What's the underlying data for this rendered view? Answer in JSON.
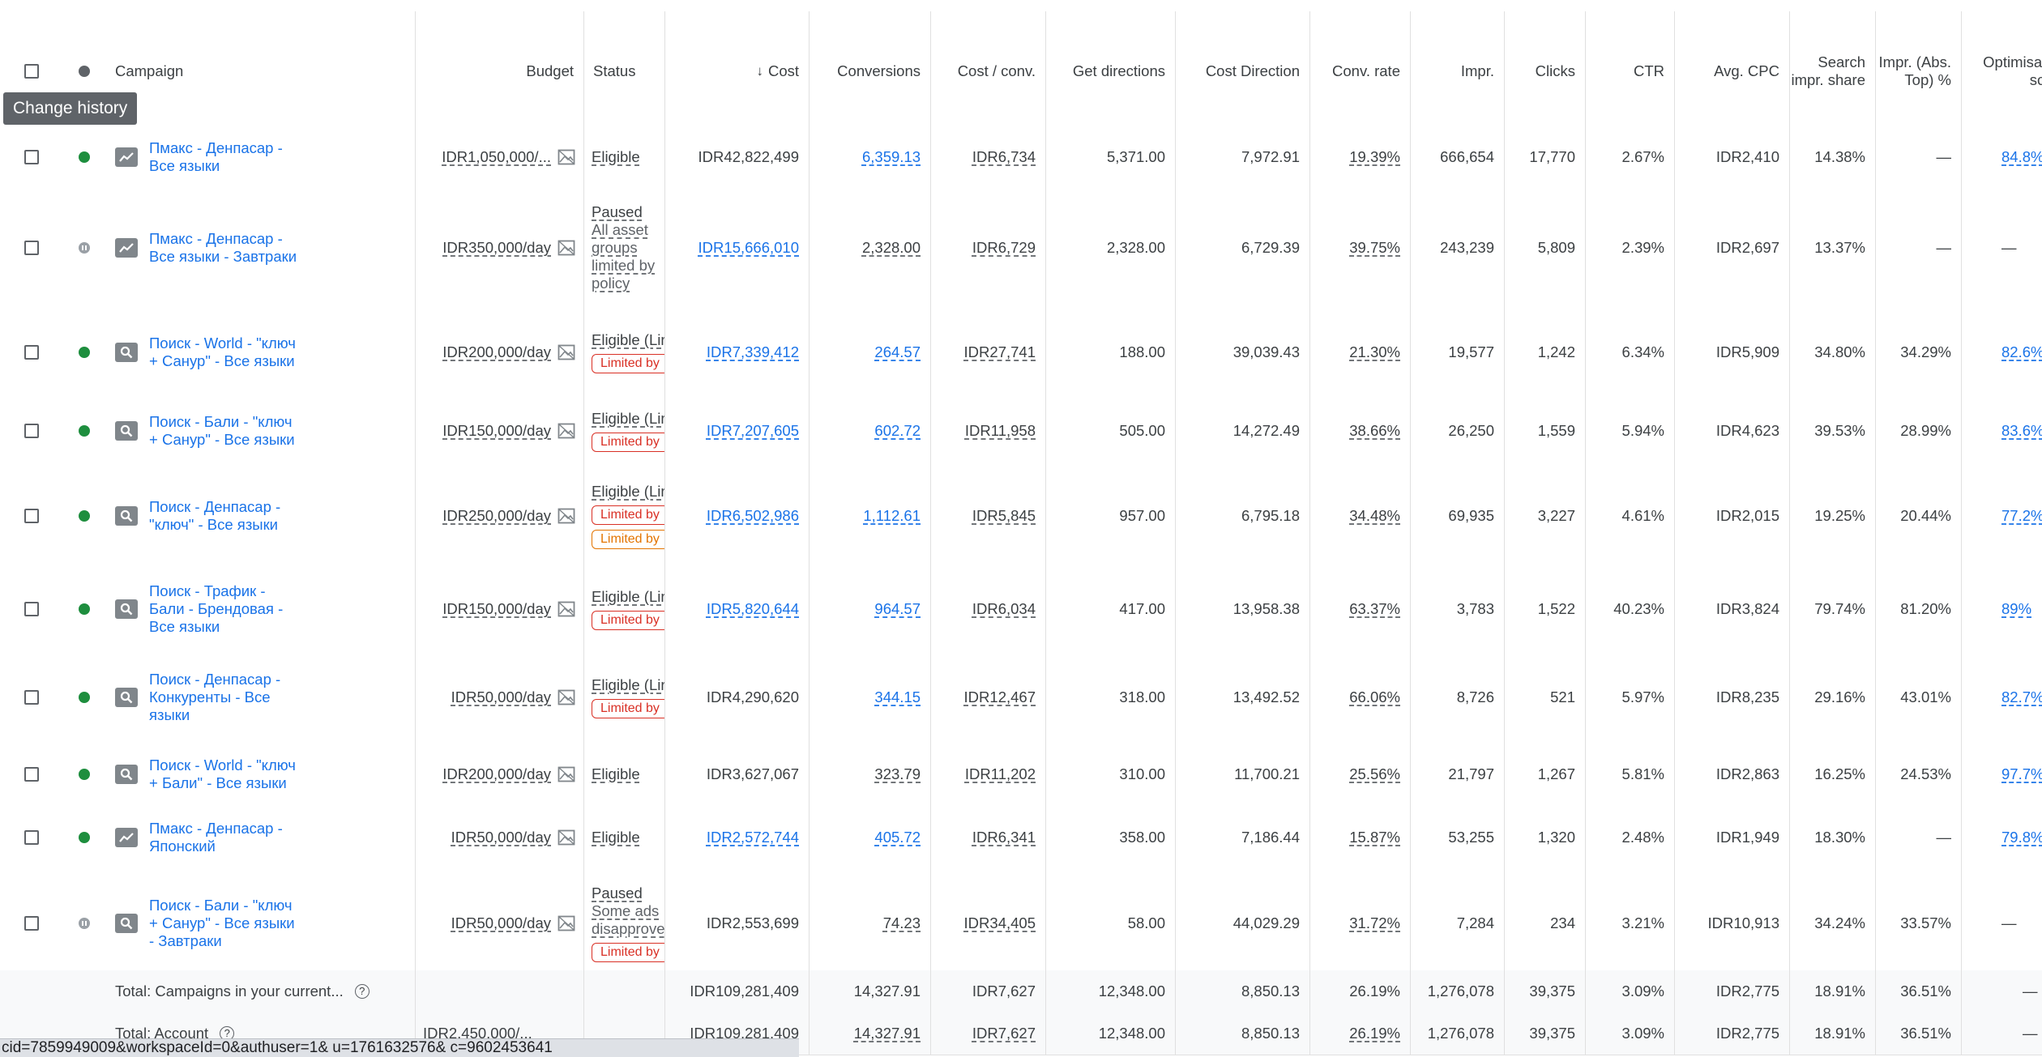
{
  "header": {
    "campaign": "Campaign",
    "budget": "Budget",
    "status": "Status",
    "cost": "Cost",
    "conversions": "Conversions",
    "cost_conv": "Cost / conv.",
    "get_directions": "Get directions",
    "cost_direction": "Cost Direction",
    "conv_rate": "Conv. rate",
    "impr": "Impr.",
    "clicks": "Clicks",
    "ctr": "CTR",
    "avg_cpc": "Avg. CPC",
    "search_impr_share": "Search impr. share",
    "impr_abs_top": "Impr. (Abs. Top) %",
    "optimisation": "Optimisation score",
    "sort_arrow": "↓"
  },
  "tooltip": "Change history",
  "rows": [
    {
      "name": "Пмакс - Денпасар - Все языки",
      "type": "pmax-icon",
      "state": "enabled",
      "budget": "IDR1,050,000/...",
      "status": "Eligible",
      "status_sub": "",
      "chips": [],
      "cost": "IDR42,822,499",
      "cost_link": false,
      "conv": "6,359.13",
      "conv_link": true,
      "cpc_conv": "IDR6,734",
      "dirs": "5,371.00",
      "cost_dir": "7,972.91",
      "conv_rate": "19.39%",
      "impr": "666,654",
      "clicks": "17,770",
      "ctr": "2.67%",
      "avg_cpc": "IDR2,410",
      "sis": "14.38%",
      "abs": "—",
      "opt": "84.8%"
    },
    {
      "name": "Пмакс - Денпасар - Все языки - Завтраки",
      "type": "pmax-icon",
      "state": "paused",
      "budget": "IDR350,000/day",
      "status": "Paused",
      "status_sub": "All asset groups limited by policy",
      "chips": [],
      "cost": "IDR15,666,010",
      "cost_link": true,
      "conv": "2,328.00",
      "conv_link": false,
      "cpc_conv": "IDR6,729",
      "dirs": "2,328.00",
      "cost_dir": "6,729.39",
      "conv_rate": "39.75%",
      "impr": "243,239",
      "clicks": "5,809",
      "ctr": "2.39%",
      "avg_cpc": "IDR2,697",
      "sis": "13.37%",
      "abs": "—",
      "opt": "—"
    },
    {
      "name": "Поиск - World - \"ключ + Санур\" - Все языки",
      "type": "search-icon",
      "state": "enabled",
      "budget": "IDR200,000/day",
      "status": "Eligible (Limited)",
      "status_sub": "",
      "chips": [
        {
          "t": "Limited by",
          "c": "red"
        }
      ],
      "cost": "IDR7,339,412",
      "cost_link": true,
      "conv": "264.57",
      "conv_link": true,
      "cpc_conv": "IDR27,741",
      "dirs": "188.00",
      "cost_dir": "39,039.43",
      "conv_rate": "21.30%",
      "impr": "19,577",
      "clicks": "1,242",
      "ctr": "6.34%",
      "avg_cpc": "IDR5,909",
      "sis": "34.80%",
      "abs": "34.29%",
      "opt": "82.6%"
    },
    {
      "name": "Поиск - Бали - \"ключ + Санур\" - Все языки",
      "type": "search-icon",
      "state": "enabled",
      "budget": "IDR150,000/day",
      "status": "Eligible (Limited)",
      "status_sub": "",
      "chips": [
        {
          "t": "Limited by",
          "c": "red"
        }
      ],
      "cost": "IDR7,207,605",
      "cost_link": true,
      "conv": "602.72",
      "conv_link": true,
      "cpc_conv": "IDR11,958",
      "dirs": "505.00",
      "cost_dir": "14,272.49",
      "conv_rate": "38.66%",
      "impr": "26,250",
      "clicks": "1,559",
      "ctr": "5.94%",
      "avg_cpc": "IDR4,623",
      "sis": "39.53%",
      "abs": "28.99%",
      "opt": "83.6%"
    },
    {
      "name": "Поиск - Денпасар - \"ключ\" - Все языки",
      "type": "search-icon",
      "state": "enabled",
      "budget": "IDR250,000/day",
      "status": "Eligible (Limited)",
      "status_sub": "",
      "chips": [
        {
          "t": "Limited by",
          "c": "red"
        },
        {
          "t": "Limited by",
          "c": "orange"
        }
      ],
      "cost": "IDR6,502,986",
      "cost_link": true,
      "conv": "1,112.61",
      "conv_link": true,
      "cpc_conv": "IDR5,845",
      "dirs": "957.00",
      "cost_dir": "6,795.18",
      "conv_rate": "34.48%",
      "impr": "69,935",
      "clicks": "3,227",
      "ctr": "4.61%",
      "avg_cpc": "IDR2,015",
      "sis": "19.25%",
      "abs": "20.44%",
      "opt": "77.2%"
    },
    {
      "name": "Поиск - Трафик - Бали - Брендовая - Все языки",
      "type": "search-icon",
      "state": "enabled",
      "budget": "IDR150,000/day",
      "status": "Eligible (Limited)",
      "status_sub": "",
      "chips": [
        {
          "t": "Limited by",
          "c": "red"
        }
      ],
      "cost": "IDR5,820,644",
      "cost_link": true,
      "conv": "964.57",
      "conv_link": true,
      "cpc_conv": "IDR6,034",
      "dirs": "417.00",
      "cost_dir": "13,958.38",
      "conv_rate": "63.37%",
      "impr": "3,783",
      "clicks": "1,522",
      "ctr": "40.23%",
      "avg_cpc": "IDR3,824",
      "sis": "79.74%",
      "abs": "81.20%",
      "opt": "89%"
    },
    {
      "name": "Поиск - Денпасар - Конкуренты - Все языки",
      "type": "search-icon",
      "state": "enabled",
      "budget": "IDR50,000/day",
      "status": "Eligible (Limited)",
      "status_sub": "",
      "chips": [
        {
          "t": "Limited by",
          "c": "red"
        }
      ],
      "cost": "IDR4,290,620",
      "cost_link": false,
      "conv": "344.15",
      "conv_link": true,
      "cpc_conv": "IDR12,467",
      "dirs": "318.00",
      "cost_dir": "13,492.52",
      "conv_rate": "66.06%",
      "impr": "8,726",
      "clicks": "521",
      "ctr": "5.97%",
      "avg_cpc": "IDR8,235",
      "sis": "29.16%",
      "abs": "43.01%",
      "opt": "82.7%"
    },
    {
      "name": "Поиск - World - \"ключ + Бали\" - Все языки",
      "type": "search-icon",
      "state": "enabled",
      "budget": "IDR200,000/day",
      "status": "Eligible",
      "status_sub": "",
      "chips": [],
      "cost": "IDR3,627,067",
      "cost_link": false,
      "conv": "323.79",
      "conv_link": false,
      "cpc_conv": "IDR11,202",
      "dirs": "310.00",
      "cost_dir": "11,700.21",
      "conv_rate": "25.56%",
      "impr": "21,797",
      "clicks": "1,267",
      "ctr": "5.81%",
      "avg_cpc": "IDR2,863",
      "sis": "16.25%",
      "abs": "24.53%",
      "opt": "97.7%"
    },
    {
      "name": "Пмакс - Денпасар - Японский",
      "type": "pmax-icon",
      "state": "enabled",
      "budget": "IDR50,000/day",
      "status": "Eligible",
      "status_sub": "",
      "chips": [],
      "cost": "IDR2,572,744",
      "cost_link": true,
      "conv": "405.72",
      "conv_link": true,
      "cpc_conv": "IDR6,341",
      "dirs": "358.00",
      "cost_dir": "7,186.44",
      "conv_rate": "15.87%",
      "impr": "53,255",
      "clicks": "1,320",
      "ctr": "2.48%",
      "avg_cpc": "IDR1,949",
      "sis": "18.30%",
      "abs": "—",
      "opt": "79.8%"
    },
    {
      "name": "Поиск - Бали - \"ключ + Санур\" - Все языки - Завтраки",
      "type": "search-icon",
      "state": "paused",
      "budget": "IDR50,000/day",
      "status": "Paused",
      "status_sub": "Some ads disapproved",
      "chips": [
        {
          "t": "Limited by",
          "c": "red"
        }
      ],
      "cost": "IDR2,553,699",
      "cost_link": false,
      "conv": "74.23",
      "conv_link": false,
      "cpc_conv": "IDR34,405",
      "dirs": "58.00",
      "cost_dir": "44,029.29",
      "conv_rate": "31.72%",
      "impr": "7,284",
      "clicks": "234",
      "ctr": "3.21%",
      "avg_cpc": "IDR10,913",
      "sis": "34.24%",
      "abs": "33.57%",
      "opt": "—"
    }
  ],
  "totals": [
    {
      "label": "Total: Campaigns in your current...",
      "budget": "",
      "cost": "IDR109,281,409",
      "conv": "14,327.91",
      "cpc_conv": "IDR7,627",
      "dirs": "12,348.00",
      "cost_dir": "8,850.13",
      "conv_rate": "26.19%",
      "impr": "1,276,078",
      "clicks": "39,375",
      "ctr": "3.09%",
      "avg_cpc": "IDR2,775",
      "sis": "18.91%",
      "abs": "36.51%",
      "opt": "—"
    },
    {
      "label": "Total: Account",
      "budget": "IDR2,450,000/...",
      "cost": "IDR109,281,409",
      "conv": "14,327.91",
      "cpc_conv": "IDR7,627",
      "dirs": "12,348.00",
      "cost_dir": "8,850.13",
      "conv_rate": "26.19%",
      "impr": "1,276,078",
      "clicks": "39,375",
      "ctr": "3.09%",
      "avg_cpc": "IDR2,775",
      "sis": "18.91%",
      "abs": "36.51%",
      "opt": "—"
    }
  ],
  "status_url": "cid=7859949009&workspaceId=0&authuser=1&    u=1761632576&    c=9602453641",
  "colors": {
    "link": "#1a73e8",
    "enabled": "#1e8e3e",
    "paused": "#9aa0a6",
    "chip_red": "#d93025",
    "chip_orange": "#e37400"
  }
}
